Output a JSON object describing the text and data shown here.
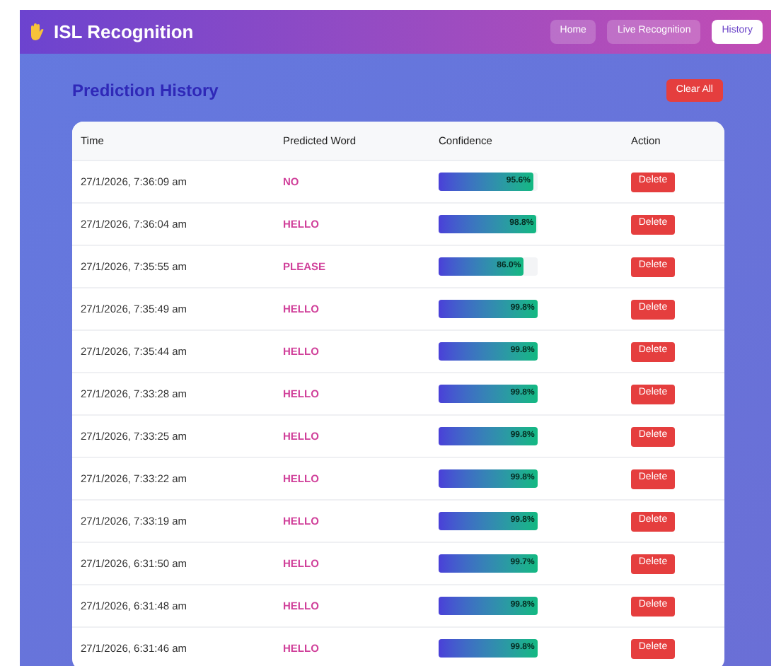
{
  "header": {
    "title": "ISL Recognition",
    "nav": [
      {
        "label": "Home",
        "selected": false
      },
      {
        "label": "Live Recognition",
        "selected": false
      },
      {
        "label": "History",
        "selected": true
      }
    ]
  },
  "page": {
    "title": "Prediction History",
    "clear_button": "Clear All"
  },
  "table": {
    "columns": [
      "Time",
      "Predicted Word",
      "Confidence",
      "Action"
    ],
    "rows": [
      {
        "time": "27/1/2026, 7:36:09 am",
        "word": "NO",
        "confidence": "95.6%",
        "level": 0.956,
        "action": "Delete"
      },
      {
        "time": "27/1/2026, 7:36:04 am",
        "word": "HELLO",
        "confidence": "98.8%",
        "level": 0.988,
        "action": "Delete"
      },
      {
        "time": "27/1/2026, 7:35:55 am",
        "word": "PLEASE",
        "confidence": "86.0%",
        "level": 0.86,
        "action": "Delete"
      },
      {
        "time": "27/1/2026, 7:35:49 am",
        "word": "HELLO",
        "confidence": "99.8%",
        "level": 0.998,
        "action": "Delete"
      },
      {
        "time": "27/1/2026, 7:35:44 am",
        "word": "HELLO",
        "confidence": "99.8%",
        "level": 0.998,
        "action": "Delete"
      },
      {
        "time": "27/1/2026, 7:33:28 am",
        "word": "HELLO",
        "confidence": "99.8%",
        "level": 0.998,
        "action": "Delete"
      },
      {
        "time": "27/1/2026, 7:33:25 am",
        "word": "HELLO",
        "confidence": "99.8%",
        "level": 0.998,
        "action": "Delete"
      },
      {
        "time": "27/1/2026, 7:33:22 am",
        "word": "HELLO",
        "confidence": "99.8%",
        "level": 0.998,
        "action": "Delete"
      },
      {
        "time": "27/1/2026, 7:33:19 am",
        "word": "HELLO",
        "confidence": "99.8%",
        "level": 0.998,
        "action": "Delete"
      },
      {
        "time": "27/1/2026, 6:31:50 am",
        "word": "HELLO",
        "confidence": "99.7%",
        "level": 0.997,
        "action": "Delete"
      },
      {
        "time": "27/1/2026, 6:31:48 am",
        "word": "HELLO",
        "confidence": "99.8%",
        "level": 0.998,
        "action": "Delete"
      },
      {
        "time": "27/1/2026, 6:31:46 am",
        "word": "HELLO",
        "confidence": "99.8%",
        "level": 0.998,
        "action": "Delete"
      }
    ]
  }
}
